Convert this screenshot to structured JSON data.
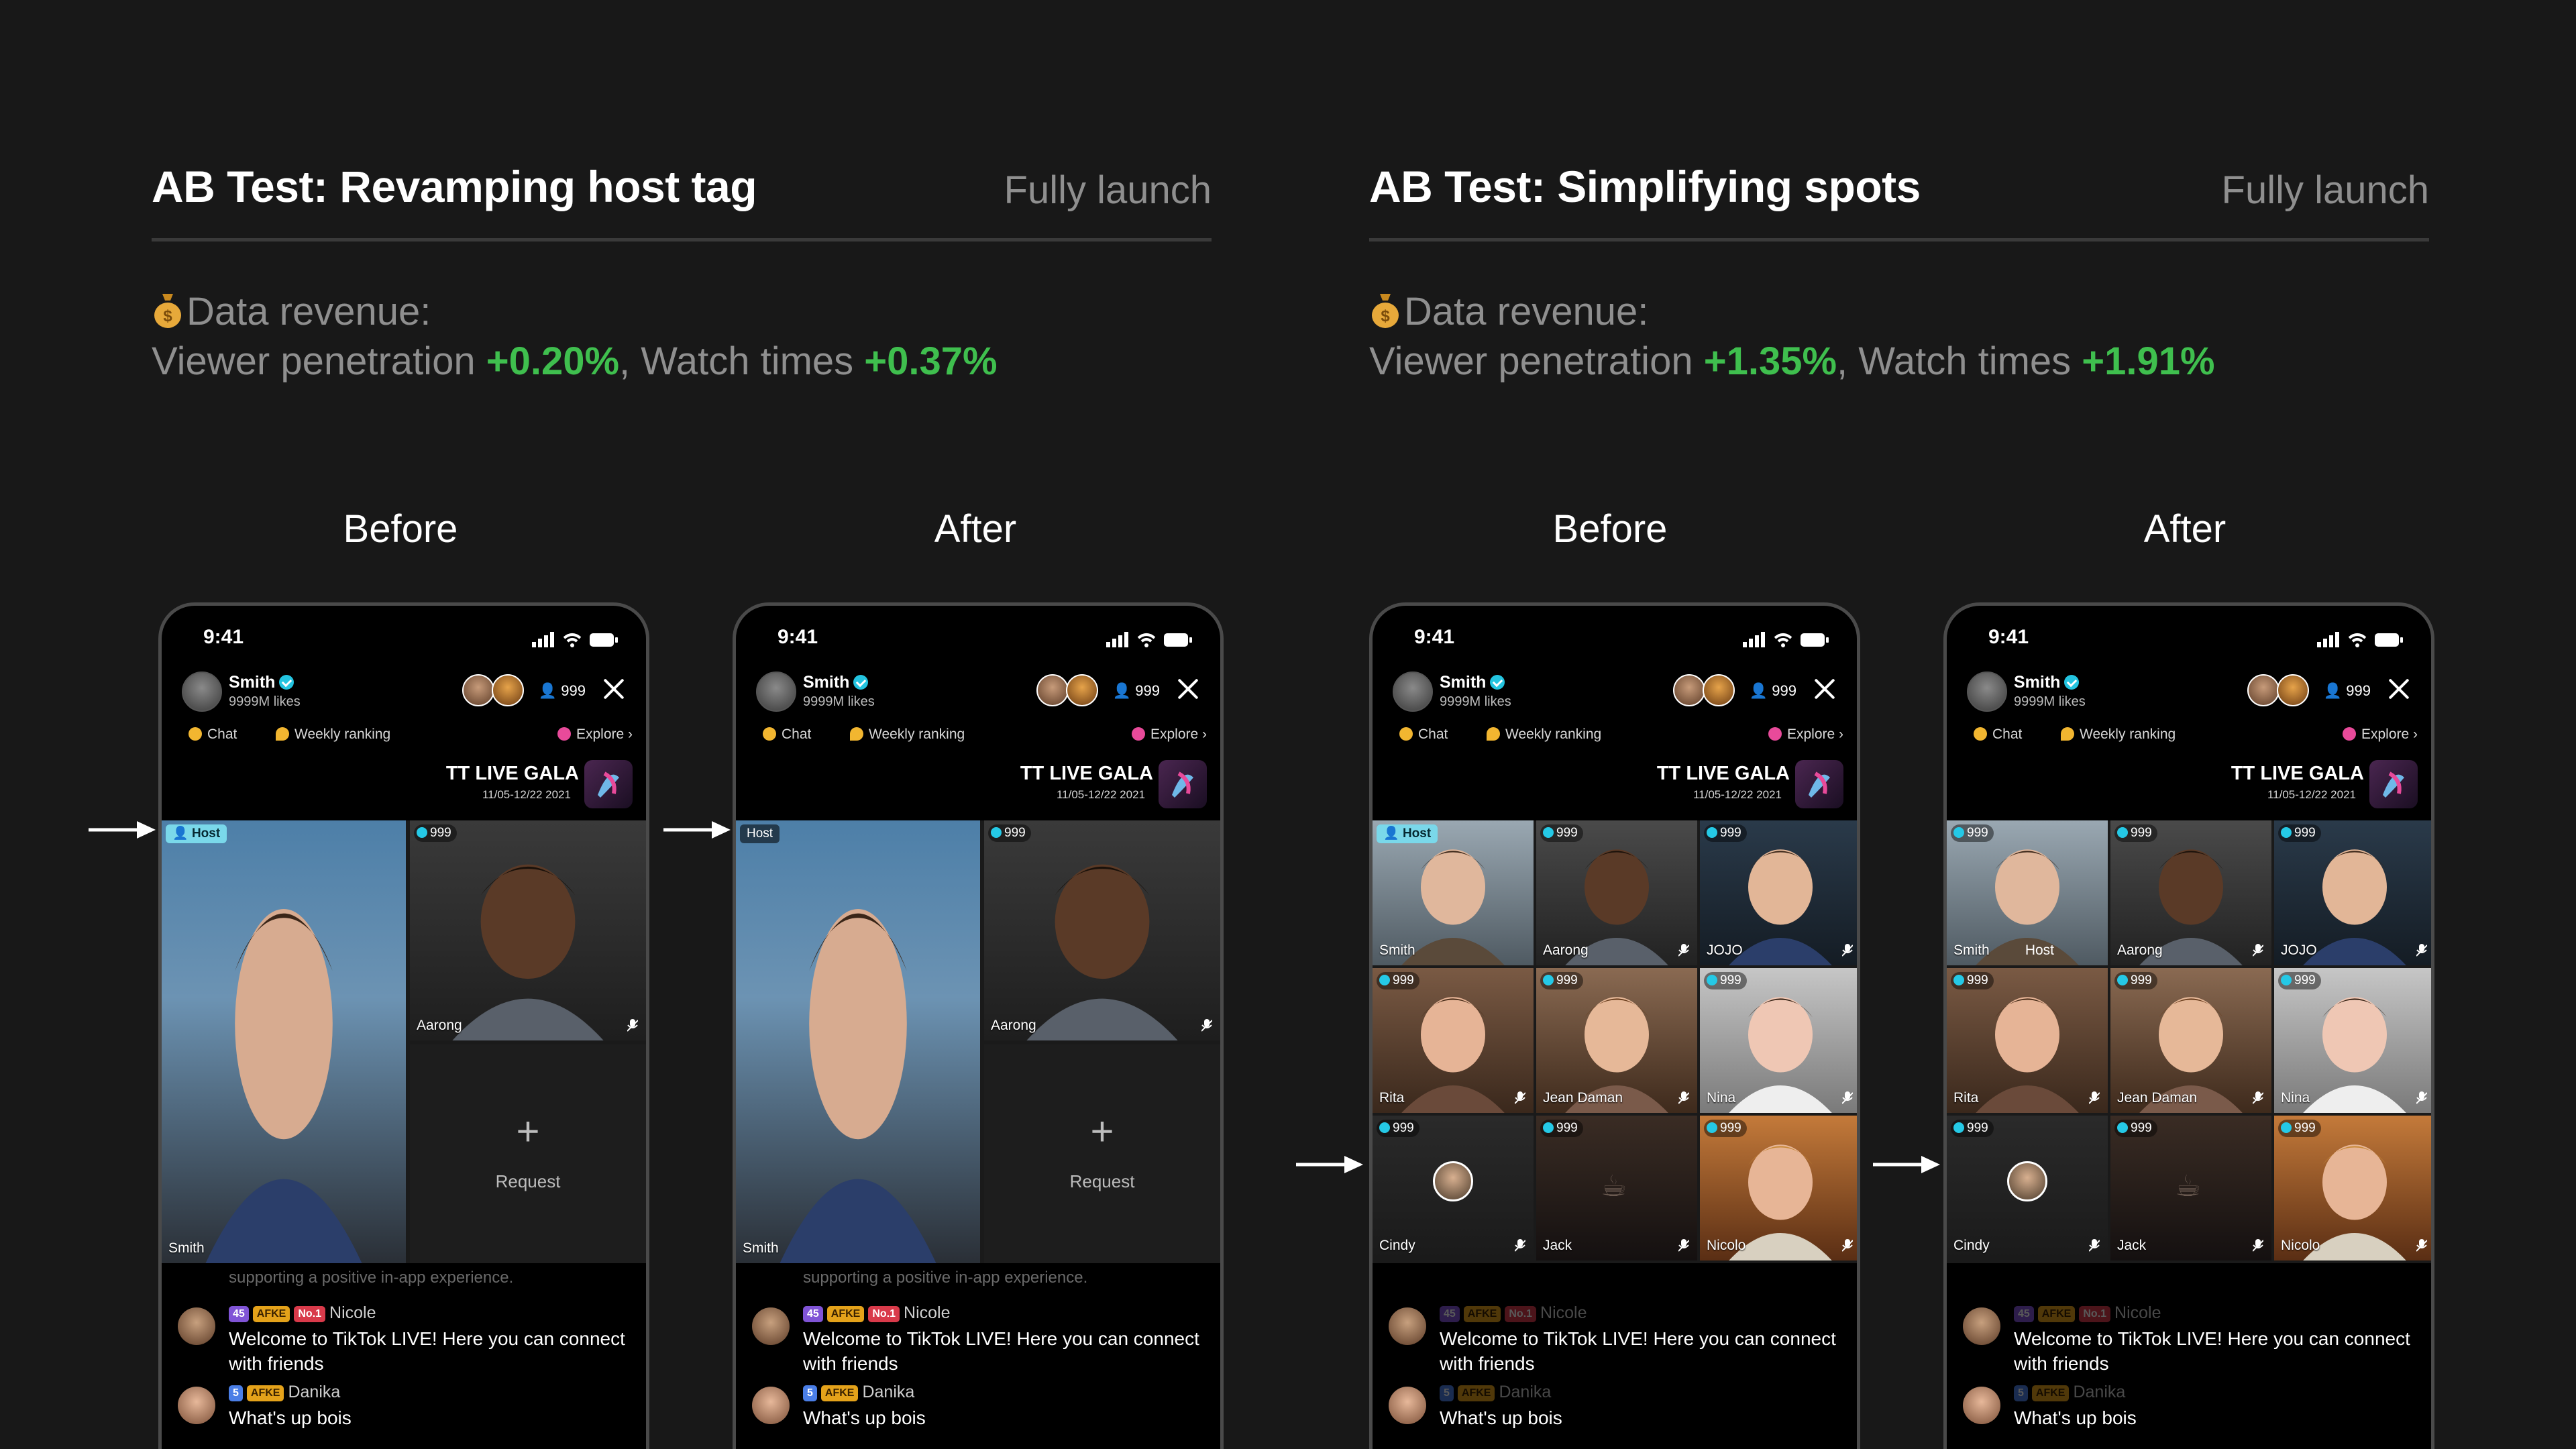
{
  "sections": [
    {
      "title": "AB Test: Revamping host tag",
      "status": "Fully launch",
      "revenue_label": "Data revenue:",
      "metric1_label": "Viewer penetration ",
      "metric1_value": "+0.20%",
      "separator": ", ",
      "metric2_label": "Watch times ",
      "metric2_value": "+0.37%"
    },
    {
      "title": "AB Test: Simplifying spots",
      "status": "Fully launch",
      "revenue_label": "Data revenue:",
      "metric1_label": "Viewer penetration ",
      "metric1_value": "+1.35%",
      "separator": ", ",
      "metric2_label": "Watch times ",
      "metric2_value": "+1.91%"
    }
  ],
  "labels": {
    "before": "Before",
    "after": "After"
  },
  "phone": {
    "time": "9:41",
    "host_name": "Smith",
    "host_likes": "9999M likes",
    "viewer_count": "999",
    "chips": {
      "chat": "Chat",
      "ranking": "Weekly ranking",
      "explore": "Explore"
    },
    "gala_title": "TT LIVE GALA",
    "gala_date": "11/05-12/22 2021",
    "host_tag": "Host",
    "tile_count": "999",
    "request_label": "Request",
    "names": {
      "smith": "Smith",
      "aarong": "Aarong",
      "jojo": "JOJO",
      "rita": "Rita",
      "jean": "Jean Daman",
      "nina": "Nina",
      "cindy": "Cindy",
      "jack": "Jack",
      "nicolo": "Nicolo"
    },
    "chat": {
      "faded": "supporting a positive in-app experience.",
      "m1_level": "45",
      "m1_badge": "AFKE",
      "m1_rank": "No.1",
      "m1_user": "Nicole",
      "m1_text": "Welcome to TikTok LIVE! Here you can connect with friends",
      "m2_level": "5",
      "m2_badge": "AFKE",
      "m2_user": "Danika",
      "m2_text": "What's up bois"
    }
  },
  "colors": {
    "positive": "#3fbf4e",
    "host_tag_new": "#7ad8ea",
    "accent_cyan": "#25c9e6"
  }
}
